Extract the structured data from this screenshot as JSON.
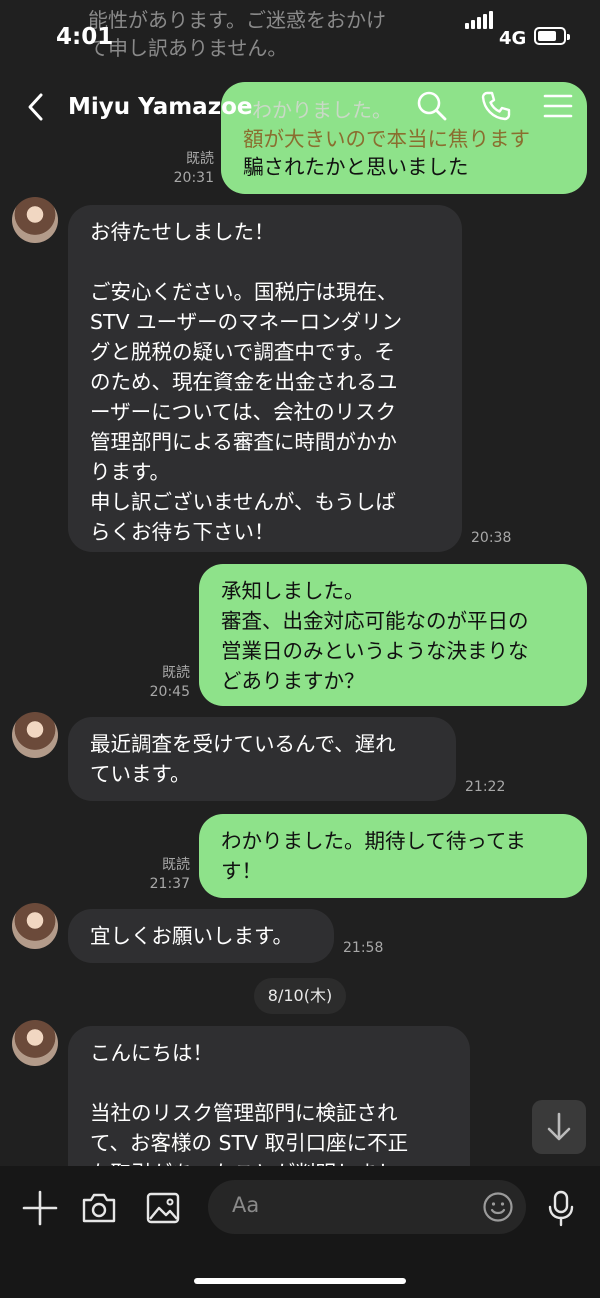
{
  "status": {
    "time": "4:01",
    "network": "4G"
  },
  "header": {
    "title": "Miyu Yamazoe",
    "ghost_line1": "能性があります。ご迷惑をおかけ",
    "ghost_line2": "て申し訳ありません。",
    "ghost_line3": "わかりました。",
    "ghost_line4": "額が大きいので本当に焦ります"
  },
  "messages": {
    "m1": {
      "text": "騙されたかと思いました",
      "read": "既読",
      "time": "20:31"
    },
    "m2": {
      "text": "お待たせしました！\n\n ご安心ください。国税庁は現在、\nSTV ユーザーのマネーロンダリン\nグと脱税の疑いで調査中です。そ\nのため、現在資金を出金されるユ\nーザーについては、会社のリスク\n管理部門による審査に時間がかか\nります。\n申し訳ございませんが、もうしば\nらくお待ち下さい！",
      "time": "20:38"
    },
    "m3": {
      "text": "承知しました。\n審査、出金対応可能なのが平日の\n営業日のみというような決まりな\nどありますか？",
      "read": "既読",
      "time": "20:45"
    },
    "m4": {
      "text": "最近調査を受けているんで、遅れ\nています。",
      "time": "21:22"
    },
    "m5": {
      "text": "わかりました。期待して待ってま\nす！",
      "read": "既読",
      "time": "21:37"
    },
    "m6": {
      "text": "宜しくお願いします。",
      "time": "21:58"
    },
    "date": "8/10(木)",
    "m7": {
      "text": "こんにちは！\n\n 当社のリスク管理部門に検証され\nて、お客様の STV 取引口座に不正\nな取引があったことが判明しまし"
    }
  },
  "input": {
    "placeholder": "Aa"
  },
  "icons": {
    "back": "chevron-left-icon",
    "search": "search-icon",
    "call": "phone-icon",
    "menu": "menu-icon",
    "plus": "plus-icon",
    "camera": "camera-icon",
    "image": "image-icon",
    "emoji": "emoji-icon",
    "mic": "mic-icon",
    "scroll": "arrow-down-icon"
  },
  "colors": {
    "outgoing": "#8ee28a",
    "incoming": "#2f2f31",
    "background": "#202020"
  }
}
